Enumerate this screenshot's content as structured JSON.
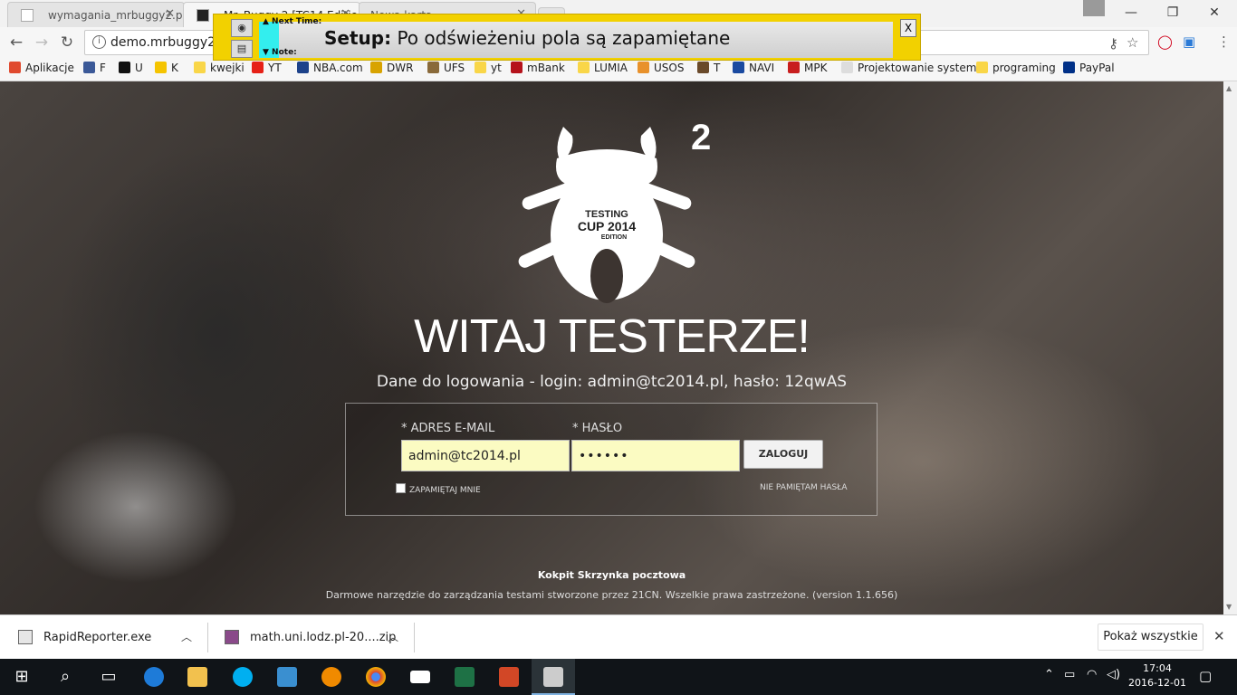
{
  "tabs": [
    {
      "label": "wymagania_mrbuggy2.p",
      "active": false
    },
    {
      "label": "Mr. Buggy 2 [TC14 Editio",
      "active": true
    },
    {
      "label": "Nowa karta",
      "active": false
    }
  ],
  "url": "demo.mrbuggy2.te",
  "bookmarks": [
    {
      "label": "Aplikacje",
      "color": "#e04a2f"
    },
    {
      "label": "F",
      "color": "#3b5998"
    },
    {
      "label": "U",
      "color": "#111111"
    },
    {
      "label": "K",
      "color": "#f5c400"
    },
    {
      "label": "kwejki",
      "color": "#f9d648"
    },
    {
      "label": "YT",
      "color": "#e62117"
    },
    {
      "label": "NBA.com",
      "color": "#1d428a"
    },
    {
      "label": "DWR",
      "color": "#d8a300"
    },
    {
      "label": "UFS",
      "color": "#8a6a3a"
    },
    {
      "label": "yt",
      "color": "#f9d648"
    },
    {
      "label": "mBank",
      "color": "#b5121b"
    },
    {
      "label": "LUMIA",
      "color": "#f9d648"
    },
    {
      "label": "USOS",
      "color": "#e8912b"
    },
    {
      "label": "T",
      "color": "#6a4a2a"
    },
    {
      "label": "NAVI",
      "color": "#1a4aa0"
    },
    {
      "label": "MPK",
      "color": "#c81e1e"
    },
    {
      "label": "Projektowanie system",
      "color": "#dddddd"
    },
    {
      "label": "programing",
      "color": "#f9d648"
    },
    {
      "label": "PayPal",
      "color": "#003087"
    }
  ],
  "rapid_reporter": {
    "next_time_label": "▲ Next Time:",
    "note_label": "▼ Note:",
    "setup_prefix": "Setup:",
    "setup_text": " Po odświeżeniu pola są zapamiętane",
    "close_label": "X"
  },
  "page": {
    "logo_superscript": "2",
    "logo_text_line1": "TESTING",
    "logo_text_line2": "CUP 2014",
    "logo_text_line3": "EDITION",
    "heading": "WITAJ TESTERZE!",
    "credentials_hint": "Dane do logowania - login: admin@tc2014.pl, hasło: 12qwAS",
    "email_label": "* ADRES E-MAIL",
    "password_label": "* HASŁO",
    "email_value": "admin@tc2014.pl",
    "password_value": "••••••",
    "login_button": "ZALOGUJ",
    "remember_me": "ZAPAMIĘTAJ MNIE",
    "forgot_password": "NIE PAMIĘTAM HASŁA",
    "footer_links": "Kokpit Skrzynka pocztowa",
    "copyright": "Darmowe narzędzie do zarządzania testami stworzone przez 21CN. Wszelkie prawa zastrzeżone. (version 1.1.656)"
  },
  "downloads": [
    {
      "name": "RapidReporter.exe"
    },
    {
      "name": "math.uni.lodz.pl-20....zip"
    }
  ],
  "show_all_label": "Pokaż wszystkie",
  "clock": {
    "time": "17:04",
    "date": "2016-12-01"
  }
}
